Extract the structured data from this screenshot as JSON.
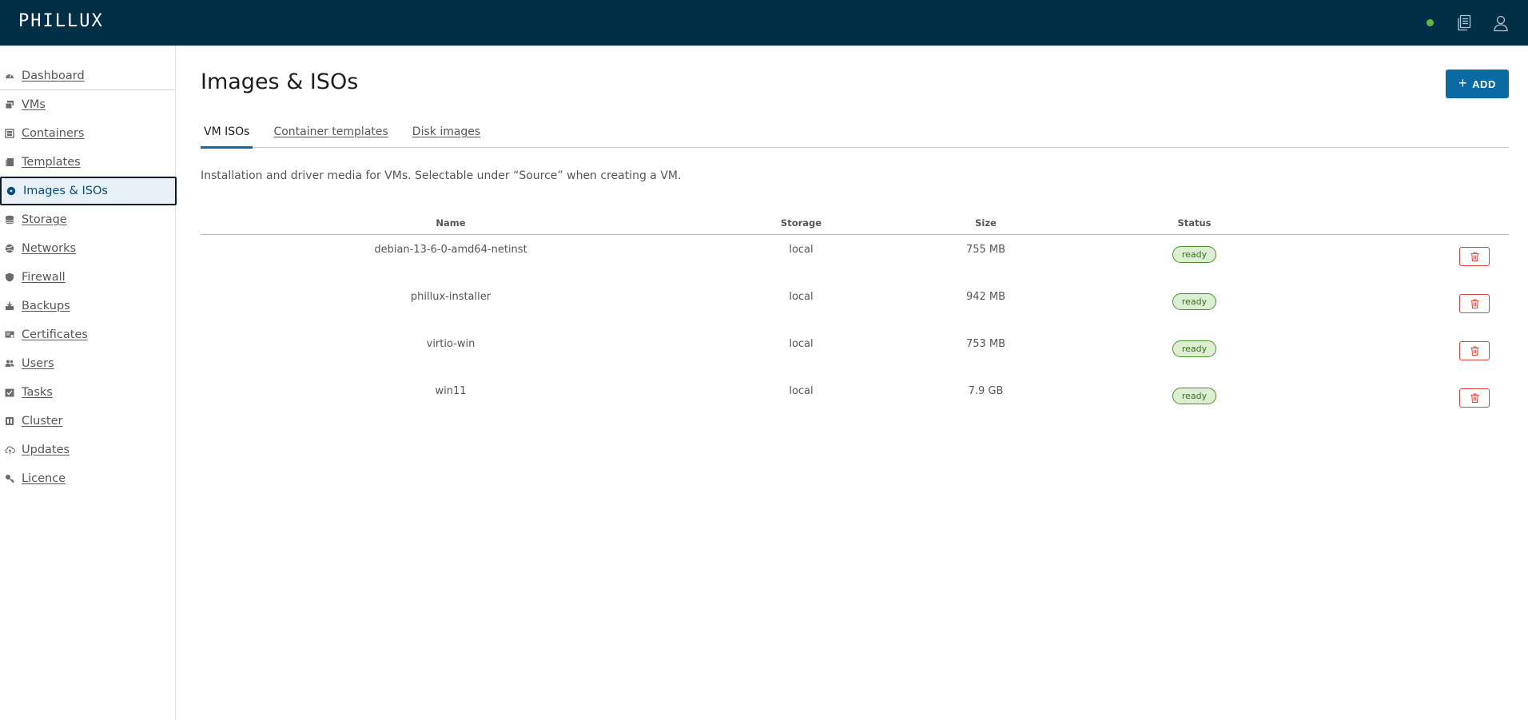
{
  "app": {
    "logo": "PHILLUX"
  },
  "header": {
    "status_color": "#62b83f",
    "icons": [
      "status-dot",
      "documents-icon",
      "user-icon"
    ]
  },
  "sidebar": {
    "items": [
      {
        "label": "Dashboard",
        "icon": "dashboard-icon"
      },
      {
        "label": "VMs",
        "icon": "vms-icon"
      },
      {
        "label": "Containers",
        "icon": "containers-icon"
      },
      {
        "label": "Templates",
        "icon": "templates-icon"
      },
      {
        "label": "Images & ISOs",
        "icon": "images-icon",
        "active": true
      },
      {
        "label": "Storage",
        "icon": "storage-icon"
      },
      {
        "label": "Networks",
        "icon": "networks-icon"
      },
      {
        "label": "Firewall",
        "icon": "firewall-icon"
      },
      {
        "label": "Backups",
        "icon": "backups-icon"
      },
      {
        "label": "Certificates",
        "icon": "certificates-icon"
      },
      {
        "label": "Users",
        "icon": "users-icon"
      },
      {
        "label": "Tasks",
        "icon": "tasks-icon"
      },
      {
        "label": "Cluster",
        "icon": "cluster-icon"
      },
      {
        "label": "Updates",
        "icon": "updates-icon"
      },
      {
        "label": "Licence",
        "icon": "licence-icon"
      }
    ]
  },
  "main": {
    "title": "Images & ISOs",
    "add_label": "ADD",
    "add_plus": "+",
    "tabs": [
      {
        "label": "VM ISOs",
        "active": true
      },
      {
        "label": "Container templates"
      },
      {
        "label": "Disk images"
      }
    ],
    "description": "Installation and driver media for VMs. Selectable under “Source” when creating a VM.",
    "table": {
      "columns": [
        "Name",
        "Storage",
        "Size",
        "Status",
        ""
      ],
      "rows": [
        {
          "name": "debian-13-6-0-amd64-netinst",
          "storage": "local",
          "size": "755 MB",
          "status": "ready"
        },
        {
          "name": "phillux-installer",
          "storage": "local",
          "size": "942 MB",
          "status": "ready"
        },
        {
          "name": "virtio-win",
          "storage": "local",
          "size": "753 MB",
          "status": "ready"
        },
        {
          "name": "win11",
          "storage": "local",
          "size": "7.9 GB",
          "status": "ready"
        }
      ]
    }
  },
  "colors": {
    "header_bg": "#002f47",
    "accent": "#0a6aa1",
    "danger": "#d9443a",
    "ready_bg": "#dcefd2",
    "ready_border": "#4e8f2d"
  }
}
